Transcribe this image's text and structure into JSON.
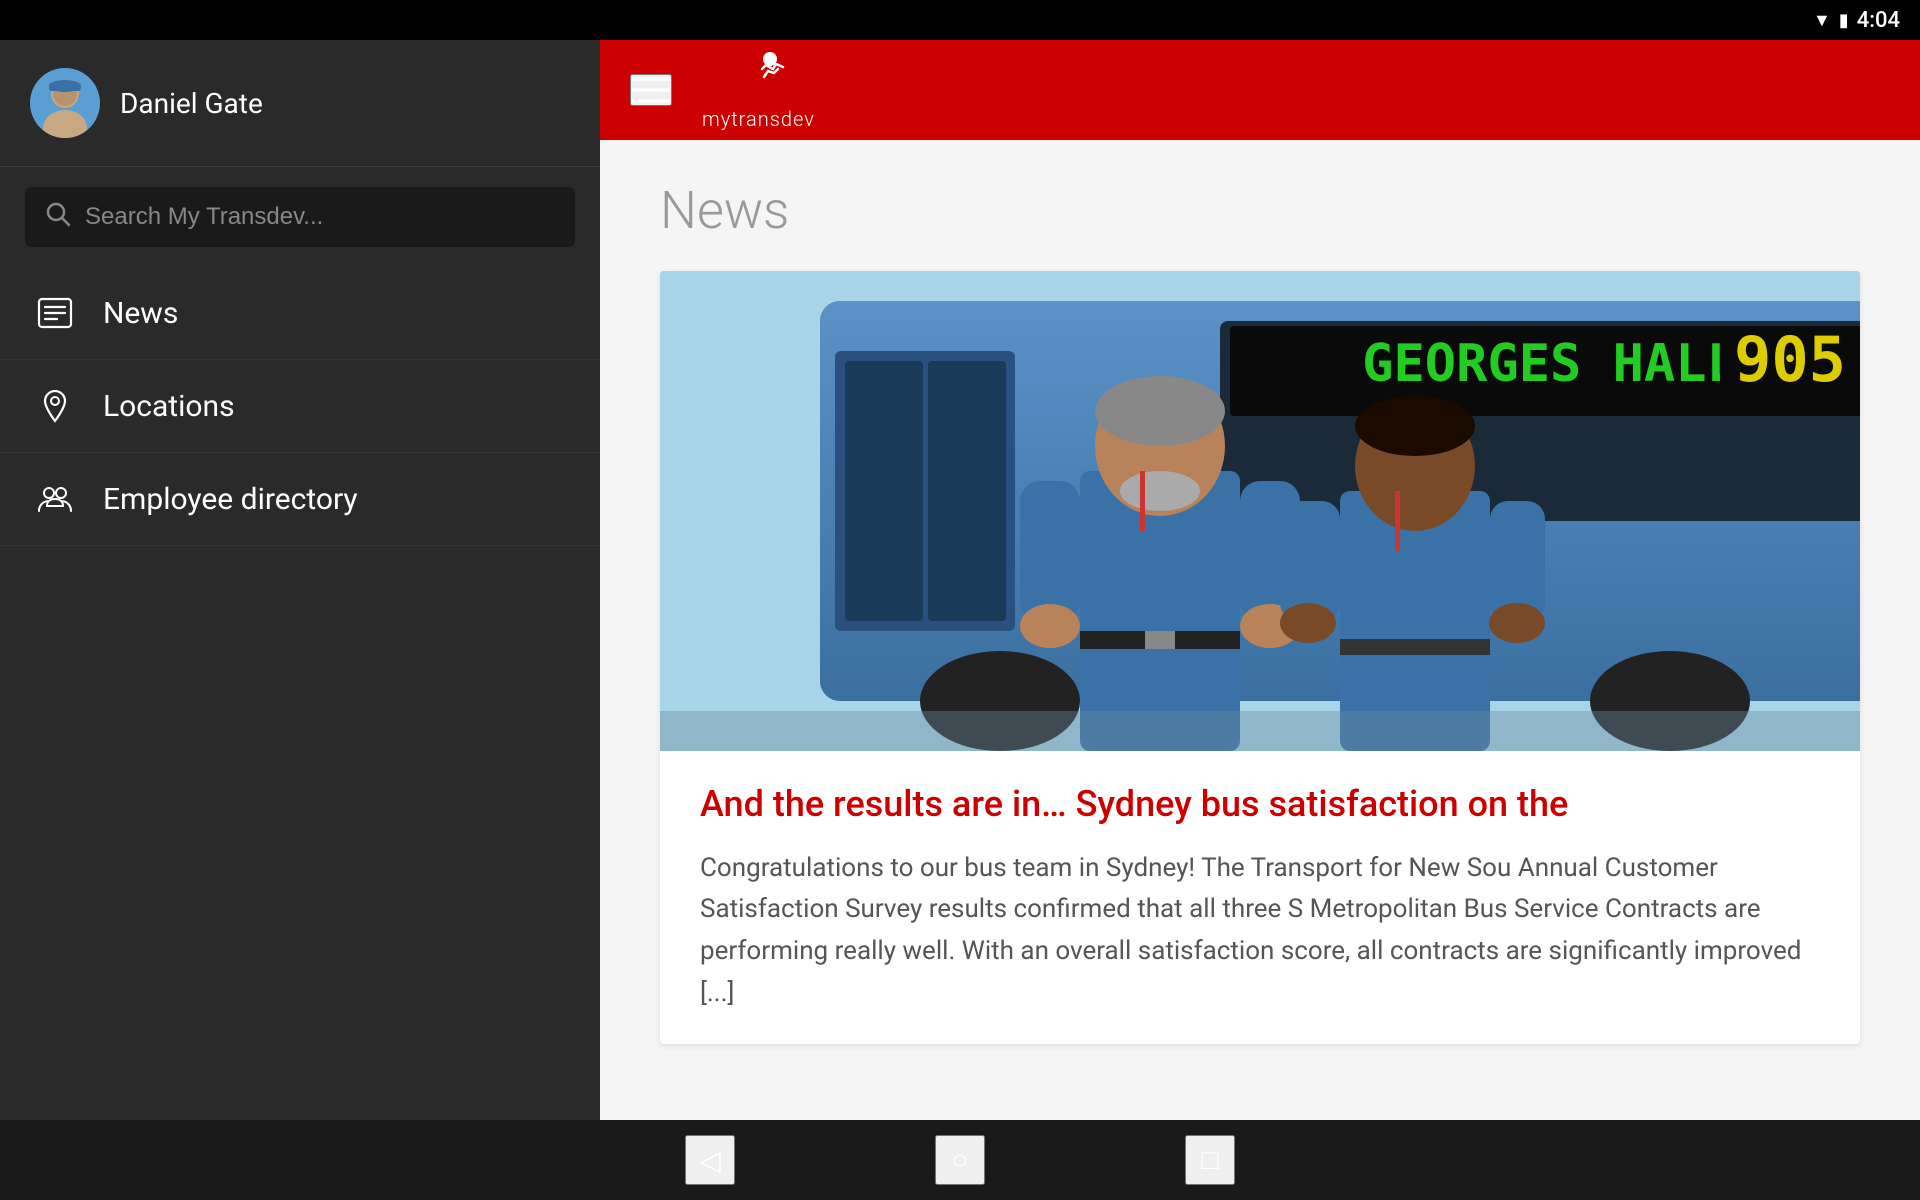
{
  "statusBar": {
    "time": "4:04"
  },
  "sidebar": {
    "user": {
      "name": "Daniel Gate"
    },
    "search": {
      "placeholder": "Search My Transdev..."
    },
    "navItems": [
      {
        "id": "news",
        "label": "News",
        "icon": "list-icon"
      },
      {
        "id": "locations",
        "label": "Locations",
        "icon": "location-icon"
      },
      {
        "id": "employee-directory",
        "label": "Employee directory",
        "icon": "people-icon"
      }
    ]
  },
  "topBar": {
    "brandName": "mytransdev",
    "menuIcon": "hamburger-icon"
  },
  "mainContent": {
    "pageTitle": "News",
    "article": {
      "imageSrc": "",
      "imageAlt": "Two bus drivers standing in front of a bus showing route 905 to Georges Hall",
      "busDestination": "GEORGES HALL",
      "busRoute": "905",
      "title": "And the results are in… Sydney bus satisfaction on the",
      "body": "Congratulations to our bus team in Sydney! The Transport for New Sou Annual Customer Satisfaction Survey results confirmed that all three S Metropolitan Bus Service Contracts are performing really well. With an overall satisfaction score, all contracts are significantly improved [...]"
    }
  },
  "navBar": {
    "back": "◁",
    "home": "○",
    "recent": "□"
  }
}
